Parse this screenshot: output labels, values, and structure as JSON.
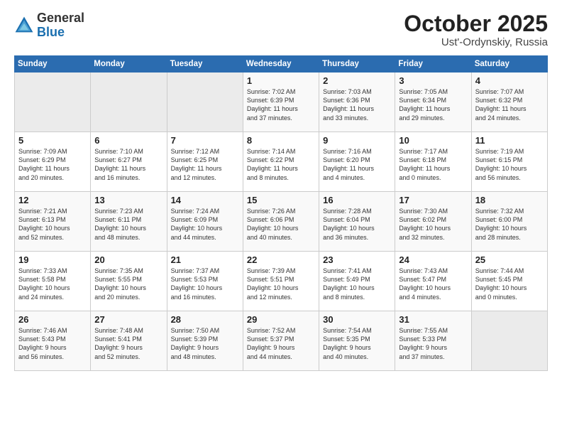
{
  "header": {
    "logo_general": "General",
    "logo_blue": "Blue",
    "month": "October 2025",
    "location": "Ust'-Ordynskiy, Russia"
  },
  "days_of_week": [
    "Sunday",
    "Monday",
    "Tuesday",
    "Wednesday",
    "Thursday",
    "Friday",
    "Saturday"
  ],
  "weeks": [
    [
      {
        "day": "",
        "text": ""
      },
      {
        "day": "",
        "text": ""
      },
      {
        "day": "",
        "text": ""
      },
      {
        "day": "1",
        "text": "Sunrise: 7:02 AM\nSunset: 6:39 PM\nDaylight: 11 hours\nand 37 minutes."
      },
      {
        "day": "2",
        "text": "Sunrise: 7:03 AM\nSunset: 6:36 PM\nDaylight: 11 hours\nand 33 minutes."
      },
      {
        "day": "3",
        "text": "Sunrise: 7:05 AM\nSunset: 6:34 PM\nDaylight: 11 hours\nand 29 minutes."
      },
      {
        "day": "4",
        "text": "Sunrise: 7:07 AM\nSunset: 6:32 PM\nDaylight: 11 hours\nand 24 minutes."
      }
    ],
    [
      {
        "day": "5",
        "text": "Sunrise: 7:09 AM\nSunset: 6:29 PM\nDaylight: 11 hours\nand 20 minutes."
      },
      {
        "day": "6",
        "text": "Sunrise: 7:10 AM\nSunset: 6:27 PM\nDaylight: 11 hours\nand 16 minutes."
      },
      {
        "day": "7",
        "text": "Sunrise: 7:12 AM\nSunset: 6:25 PM\nDaylight: 11 hours\nand 12 minutes."
      },
      {
        "day": "8",
        "text": "Sunrise: 7:14 AM\nSunset: 6:22 PM\nDaylight: 11 hours\nand 8 minutes."
      },
      {
        "day": "9",
        "text": "Sunrise: 7:16 AM\nSunset: 6:20 PM\nDaylight: 11 hours\nand 4 minutes."
      },
      {
        "day": "10",
        "text": "Sunrise: 7:17 AM\nSunset: 6:18 PM\nDaylight: 11 hours\nand 0 minutes."
      },
      {
        "day": "11",
        "text": "Sunrise: 7:19 AM\nSunset: 6:15 PM\nDaylight: 10 hours\nand 56 minutes."
      }
    ],
    [
      {
        "day": "12",
        "text": "Sunrise: 7:21 AM\nSunset: 6:13 PM\nDaylight: 10 hours\nand 52 minutes."
      },
      {
        "day": "13",
        "text": "Sunrise: 7:23 AM\nSunset: 6:11 PM\nDaylight: 10 hours\nand 48 minutes."
      },
      {
        "day": "14",
        "text": "Sunrise: 7:24 AM\nSunset: 6:09 PM\nDaylight: 10 hours\nand 44 minutes."
      },
      {
        "day": "15",
        "text": "Sunrise: 7:26 AM\nSunset: 6:06 PM\nDaylight: 10 hours\nand 40 minutes."
      },
      {
        "day": "16",
        "text": "Sunrise: 7:28 AM\nSunset: 6:04 PM\nDaylight: 10 hours\nand 36 minutes."
      },
      {
        "day": "17",
        "text": "Sunrise: 7:30 AM\nSunset: 6:02 PM\nDaylight: 10 hours\nand 32 minutes."
      },
      {
        "day": "18",
        "text": "Sunrise: 7:32 AM\nSunset: 6:00 PM\nDaylight: 10 hours\nand 28 minutes."
      }
    ],
    [
      {
        "day": "19",
        "text": "Sunrise: 7:33 AM\nSunset: 5:58 PM\nDaylight: 10 hours\nand 24 minutes."
      },
      {
        "day": "20",
        "text": "Sunrise: 7:35 AM\nSunset: 5:55 PM\nDaylight: 10 hours\nand 20 minutes."
      },
      {
        "day": "21",
        "text": "Sunrise: 7:37 AM\nSunset: 5:53 PM\nDaylight: 10 hours\nand 16 minutes."
      },
      {
        "day": "22",
        "text": "Sunrise: 7:39 AM\nSunset: 5:51 PM\nDaylight: 10 hours\nand 12 minutes."
      },
      {
        "day": "23",
        "text": "Sunrise: 7:41 AM\nSunset: 5:49 PM\nDaylight: 10 hours\nand 8 minutes."
      },
      {
        "day": "24",
        "text": "Sunrise: 7:43 AM\nSunset: 5:47 PM\nDaylight: 10 hours\nand 4 minutes."
      },
      {
        "day": "25",
        "text": "Sunrise: 7:44 AM\nSunset: 5:45 PM\nDaylight: 10 hours\nand 0 minutes."
      }
    ],
    [
      {
        "day": "26",
        "text": "Sunrise: 7:46 AM\nSunset: 5:43 PM\nDaylight: 9 hours\nand 56 minutes."
      },
      {
        "day": "27",
        "text": "Sunrise: 7:48 AM\nSunset: 5:41 PM\nDaylight: 9 hours\nand 52 minutes."
      },
      {
        "day": "28",
        "text": "Sunrise: 7:50 AM\nSunset: 5:39 PM\nDaylight: 9 hours\nand 48 minutes."
      },
      {
        "day": "29",
        "text": "Sunrise: 7:52 AM\nSunset: 5:37 PM\nDaylight: 9 hours\nand 44 minutes."
      },
      {
        "day": "30",
        "text": "Sunrise: 7:54 AM\nSunset: 5:35 PM\nDaylight: 9 hours\nand 40 minutes."
      },
      {
        "day": "31",
        "text": "Sunrise: 7:55 AM\nSunset: 5:33 PM\nDaylight: 9 hours\nand 37 minutes."
      },
      {
        "day": "",
        "text": ""
      }
    ]
  ]
}
